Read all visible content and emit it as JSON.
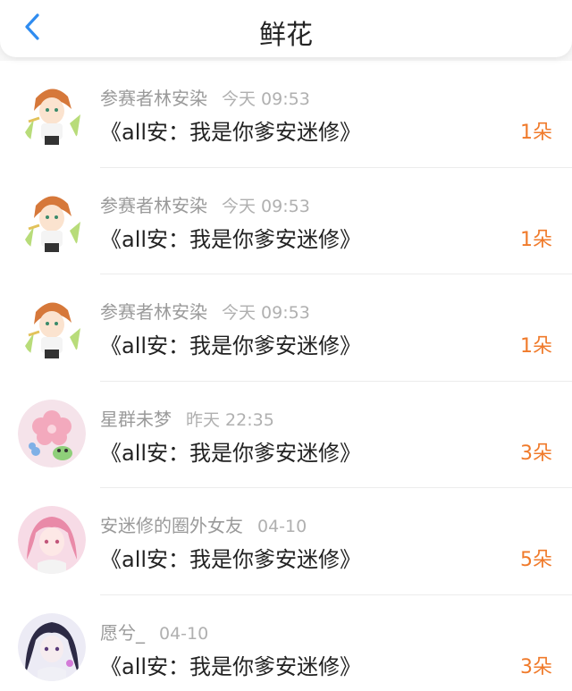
{
  "header": {
    "title": "鲜花",
    "back_icon": "chevron-left-icon",
    "accent_color": "#2f8cf0"
  },
  "flowers_list": [
    {
      "user": "参赛者林安染",
      "time": "今天 09:53",
      "work": "《all安：我是你爹安迷修》",
      "count": "1朵",
      "avatar": "anime-boy-orange-hair"
    },
    {
      "user": "参赛者林安染",
      "time": "今天 09:53",
      "work": "《all安：我是你爹安迷修》",
      "count": "1朵",
      "avatar": "anime-boy-orange-hair"
    },
    {
      "user": "参赛者林安染",
      "time": "今天 09:53",
      "work": "《all安：我是你爹安迷修》",
      "count": "1朵",
      "avatar": "anime-boy-orange-hair"
    },
    {
      "user": "星群未梦",
      "time": "昨天 22:35",
      "work": "《all安：我是你爹安迷修》",
      "count": "3朵",
      "avatar": "pink-flower-frog"
    },
    {
      "user": "安迷修的圈外女友",
      "time": "04-10",
      "work": "《all安：我是你爹安迷修》",
      "count": "5朵",
      "avatar": "anime-girl-pink-hair"
    },
    {
      "user": "愿兮_",
      "time": "04-10",
      "work": "《all安：我是你爹安迷修》",
      "count": "3朵",
      "avatar": "anime-girl-dark-hair"
    }
  ],
  "colors": {
    "count": "#f07a2a",
    "meta": "#9a9a9a",
    "text": "#222222"
  }
}
